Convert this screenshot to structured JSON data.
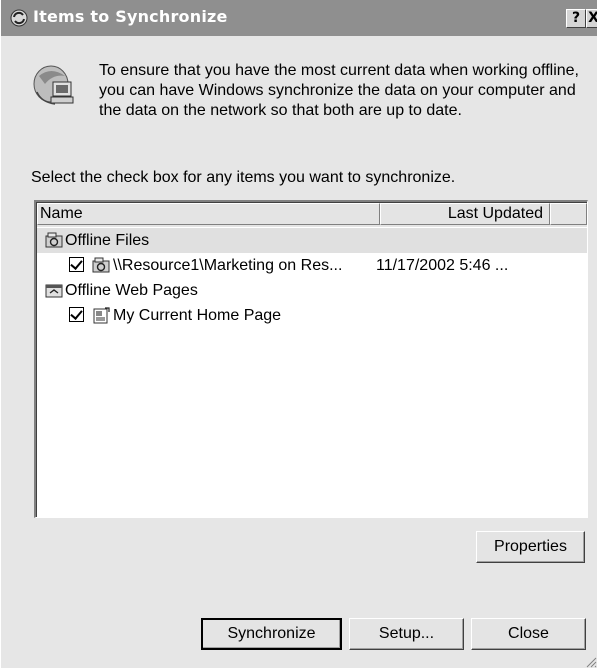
{
  "window": {
    "title": "Items to Synchronize",
    "help_label": "?",
    "close_label": "X"
  },
  "intro": {
    "text": "To ensure that you have the most current data when working offline, you can have Windows synchronize the data on your computer and the data on the network so that both are up to date."
  },
  "instruction": "Select the check box for any items you want to synchronize.",
  "list": {
    "columns": [
      "Name",
      "Last Updated"
    ],
    "groups": [
      {
        "label": "Offline Files",
        "items": [
          {
            "checked": true,
            "name": "\\\\Resource1\\Marketing on Res...",
            "last_updated": "11/17/2002 5:46 ..."
          }
        ]
      },
      {
        "label": "Offline Web Pages",
        "items": [
          {
            "checked": true,
            "name": "My Current Home Page",
            "last_updated": ""
          }
        ]
      }
    ]
  },
  "buttons": {
    "properties": "Properties",
    "synchronize": "Synchronize",
    "setup": "Setup...",
    "close": "Close"
  },
  "icons": {
    "title": "sync-icon",
    "intro": "computer-network-icon",
    "offline_files": "offline-files-icon",
    "offline_web": "offline-web-pages-icon",
    "page": "web-page-icon"
  }
}
